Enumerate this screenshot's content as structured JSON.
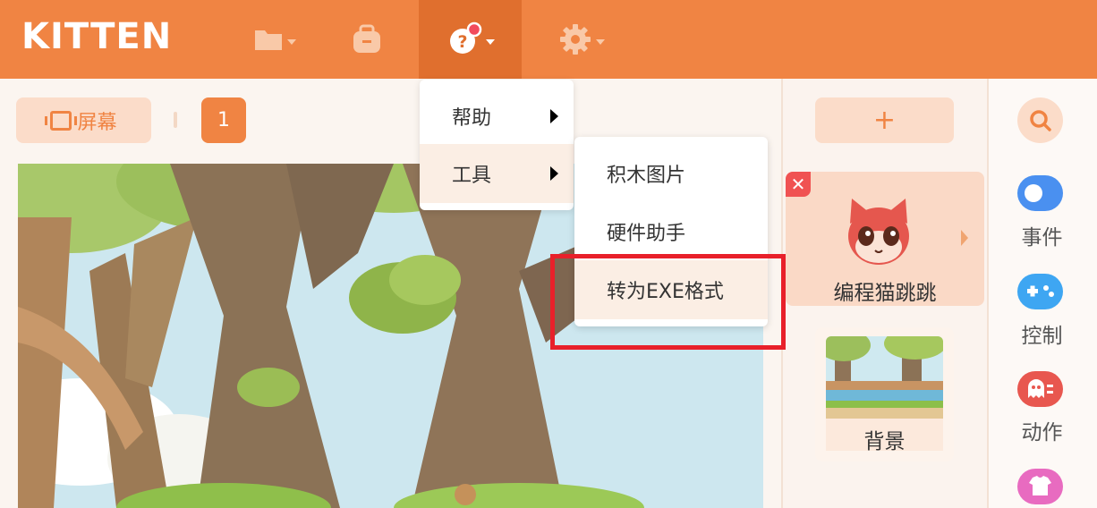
{
  "app": {
    "logo": "KITTEN"
  },
  "toolbar": {
    "items": [
      {
        "icon": "folder-icon",
        "has_dropdown": true
      },
      {
        "icon": "backpack-icon",
        "has_dropdown": false
      },
      {
        "icon": "help-icon",
        "has_dropdown": true,
        "active": true,
        "has_notification": true
      },
      {
        "icon": "gear-icon",
        "has_dropdown": true
      }
    ]
  },
  "stage_controls": {
    "screen_label": "屏幕",
    "page_number": "1"
  },
  "help_menu": {
    "items": [
      {
        "label": "帮助",
        "has_submenu": true
      },
      {
        "label": "工具",
        "has_submenu": true,
        "highlighted": true
      }
    ]
  },
  "tools_submenu": {
    "items": [
      {
        "label": "积木图片"
      },
      {
        "label": "硬件助手"
      },
      {
        "label": "转为EXE格式",
        "highlighted": true
      }
    ]
  },
  "sprites": {
    "add_label": "+",
    "items": [
      {
        "name": "编程猫跳跳",
        "selected": true
      }
    ],
    "background": {
      "label": "背景"
    }
  },
  "categories": {
    "items": [
      {
        "label": "事件",
        "icon": "event-toggle-icon",
        "color": "#4a90f0"
      },
      {
        "label": "控制",
        "icon": "gamepad-icon",
        "color": "#3ea6f2"
      },
      {
        "label": "动作",
        "icon": "ghost-icon",
        "color": "#e8574f"
      },
      {
        "label": "",
        "icon": "shirt-icon",
        "color": "#e86bc0"
      }
    ]
  },
  "colors": {
    "brand": "#f08443",
    "highlight_box": "#e8202a"
  }
}
